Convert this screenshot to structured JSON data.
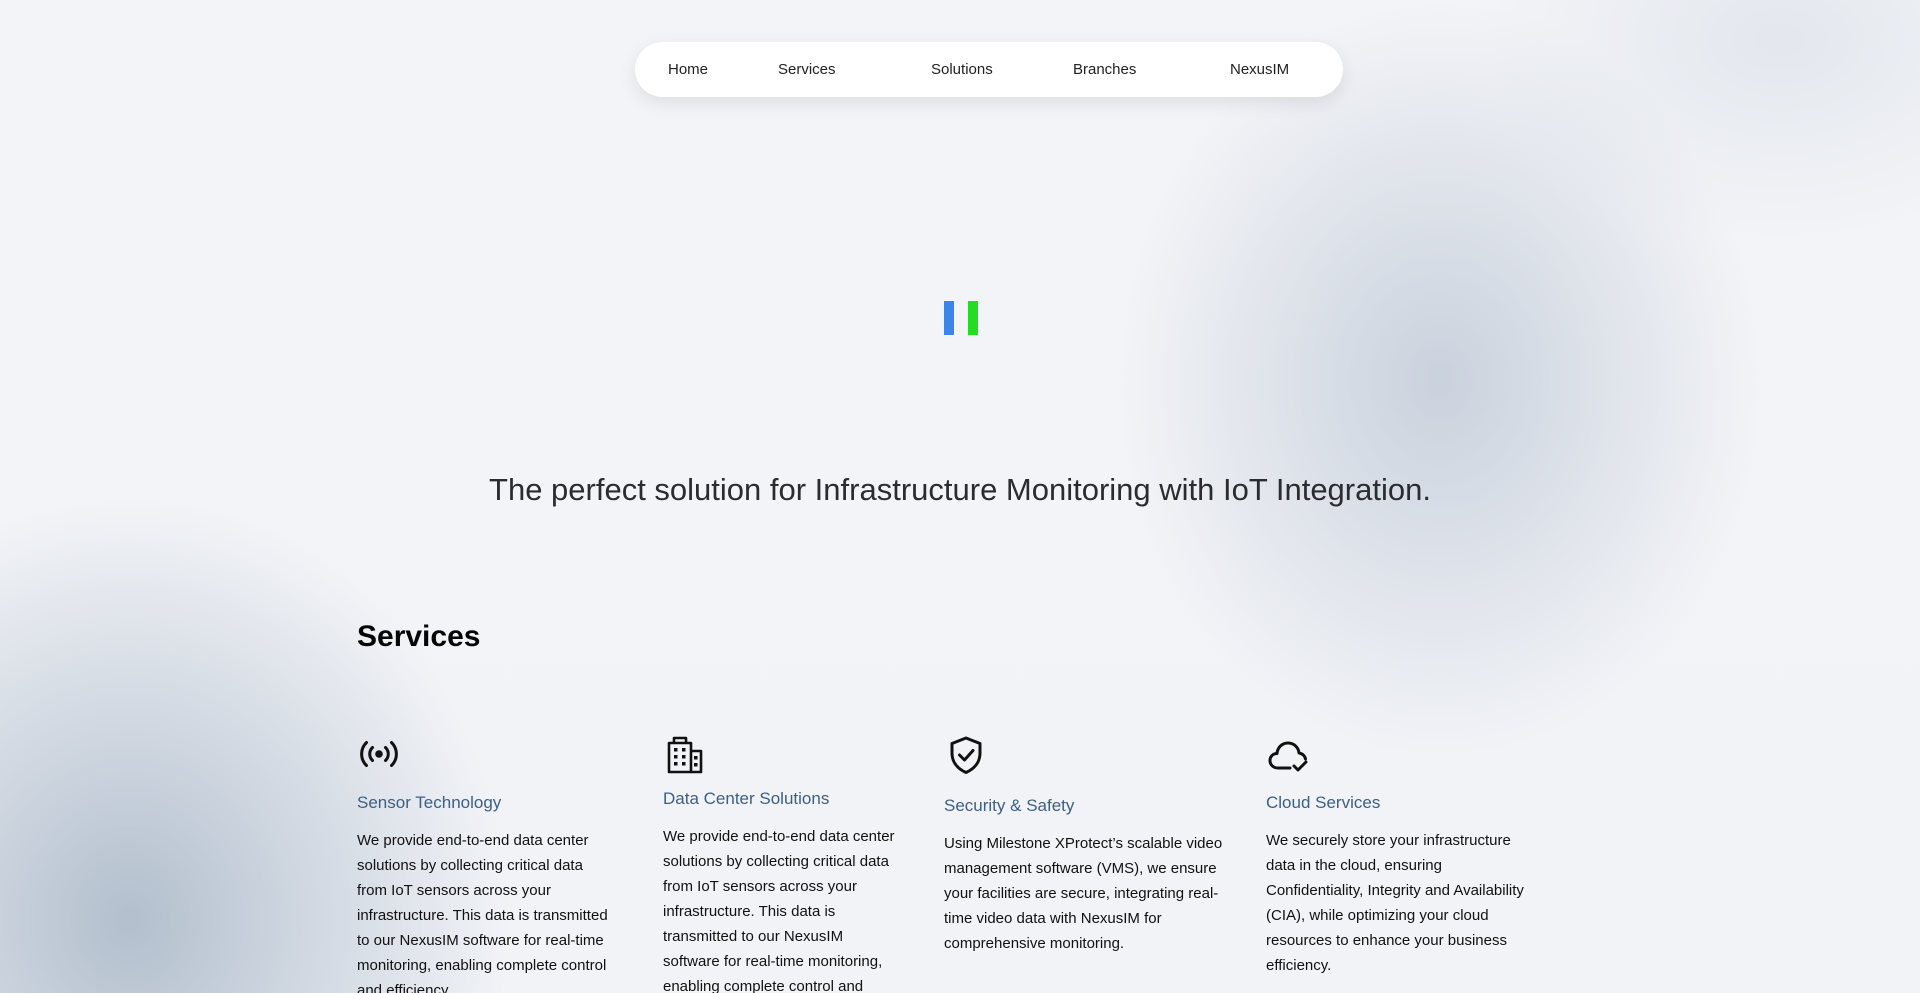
{
  "nav": {
    "items": [
      {
        "label": "Home"
      },
      {
        "label": "Services"
      },
      {
        "label": "Solutions"
      },
      {
        "label": "Branches"
      },
      {
        "label": "NexusIM"
      }
    ]
  },
  "logo": {
    "colors": [
      "#3a86e8",
      "#22dd22"
    ]
  },
  "hero": {
    "tagline": "The perfect solution for Infrastructure Monitoring with IoT Integration."
  },
  "services": {
    "title": "Services",
    "items": [
      {
        "icon": "sensor-icon",
        "title": "Sensor Technology",
        "description": "We provide end-to-end data center solutions by collecting critical data from IoT sensors across your infrastructure. This data is transmitted to our NexusIM software for real-time monitoring, enabling complete control and efficiency."
      },
      {
        "icon": "building-icon",
        "title": "Data Center Solutions",
        "description": "We provide end-to-end data center solutions by collecting critical data from IoT sensors across your infrastructure. This data is transmitted to our NexusIM software for real-time monitoring, enabling complete control and efficiency."
      },
      {
        "icon": "shield-check-icon",
        "title": "Security & Safety",
        "description": "Using Milestone XProtect’s scalable video management software (VMS), we ensure your facilities are secure, integrating real-time video data with NexusIM for comprehensive monitoring."
      },
      {
        "icon": "cloud-check-icon",
        "title": "Cloud Services",
        "description": "We securely store your infrastructure data in the cloud, ensuring Confidentiality, Integrity and Availability (CIA), while optimizing your cloud resources to enhance your business efficiency."
      }
    ]
  },
  "colors": {
    "accent": "#3d5f82",
    "background": "#f2f4f8"
  }
}
